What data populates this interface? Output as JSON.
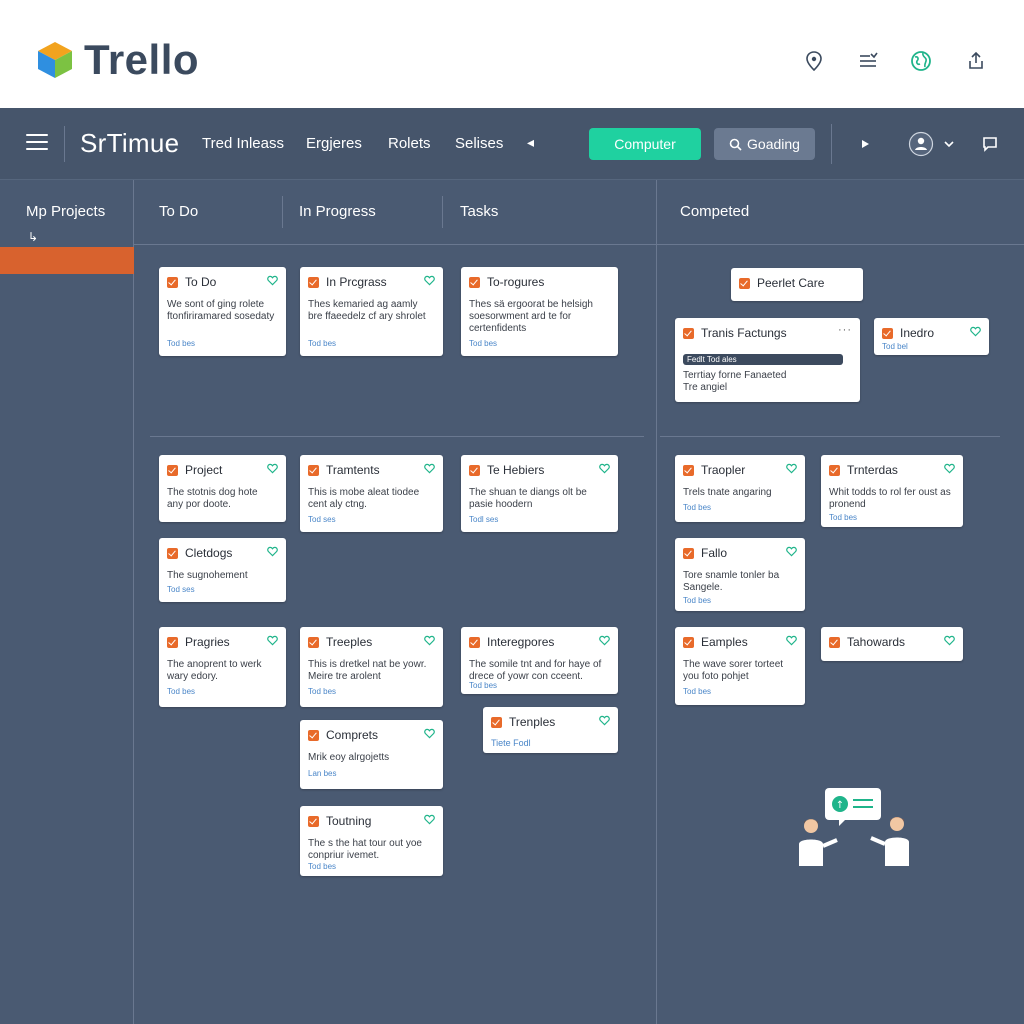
{
  "brand": {
    "logo_text": "Trello",
    "icons": [
      "location-pin-icon",
      "sort-list-icon",
      "globe-icon",
      "share-upload-icon"
    ]
  },
  "nav": {
    "title": "SrTimue",
    "links": [
      "Tred Inleass",
      "Ergjeres",
      "Rolets",
      "Selises"
    ],
    "primary_button": "Computer",
    "search_button": "Goading",
    "colors": {
      "primary": "#1fd1a0",
      "accent": "#d8622e",
      "background": "#4a5a72"
    }
  },
  "sidebar": {
    "title": "Mp Projects"
  },
  "columns": {
    "todo": "To Do",
    "inprogress": "In Progress",
    "tasks": "Tasks",
    "completed": "Competed"
  },
  "cards": {
    "c1": {
      "title": "To Do",
      "desc": "We sont of ging rolete ftonfiriramared sosedaty",
      "link": "Tod bes"
    },
    "c2": {
      "title": "In Prcgrass",
      "desc": "Thes kemaried ag aamly bre ffaeedelz cf ary shrolet",
      "link": "Tod bes"
    },
    "c3": {
      "title": "To-rogures",
      "desc": "Thes sä ergoorat be helsigh soesorwment ard te for certenfidents",
      "link": "Tod bes"
    },
    "c4": {
      "title": "Project",
      "desc": "The stotnis dog hote any por doote.",
      "link": ""
    },
    "c5": {
      "title": "Tramtents",
      "desc": "This is mobe aleat tiodee cent aly ctng.",
      "link": "Tod ses"
    },
    "c6": {
      "title": "Te Hebiers",
      "desc": "The shuan te diangs olt be pasie hoodern",
      "link": "Todl ses"
    },
    "c7": {
      "title": "Cletdogs",
      "desc": "The sugnohement",
      "link": "Tod ses"
    },
    "c8": {
      "title": "Pragries",
      "desc": "The anoprent to werk wary edory.",
      "link": "Tod bes"
    },
    "c9": {
      "title": "Treeples",
      "desc": "This is dretkel nat be yowr. Meire tre arolent",
      "link": "Tod bes"
    },
    "c10": {
      "title": "Interegpores",
      "desc": "The somile tnt and for haye of drece of yowr con cceent.",
      "link": "Tod bes"
    },
    "c11": {
      "title": "Trenples",
      "desc": "",
      "link": "Tiete Fodl"
    },
    "c12": {
      "title": "Comprets",
      "desc": "Mrik eoy alrgojetts",
      "link": "Lan bes"
    },
    "c13": {
      "title": "Toutning",
      "desc": "The s the hat tour out yoe conpriur ivemet.",
      "link": "Tod bes"
    },
    "c14": {
      "title": "Peerlet Care"
    },
    "c15": {
      "title": "Tranis Factungs",
      "input": "Fedlt Tod ales",
      "desc": "Terrtiay forne Fanaeted Tre angiel"
    },
    "c16": {
      "title": "Inedro",
      "link": "Tod bel"
    },
    "c17": {
      "title": "Traopler",
      "desc": "Trels tnate angaring",
      "link": "Tod bes"
    },
    "c18": {
      "title": "Trnterdas",
      "desc": "Whit todds to rol fer oust as pronend",
      "link": "Tod bes"
    },
    "c19": {
      "title": "Fallo",
      "desc": "Tore snamle tonler ba Sangele.",
      "link": "Tod bes"
    },
    "c20": {
      "title": "Eamples",
      "desc": "The wave sorer torteet you foto pohjet",
      "link": "Tod bes"
    },
    "c21": {
      "title": "Tahowards"
    }
  }
}
